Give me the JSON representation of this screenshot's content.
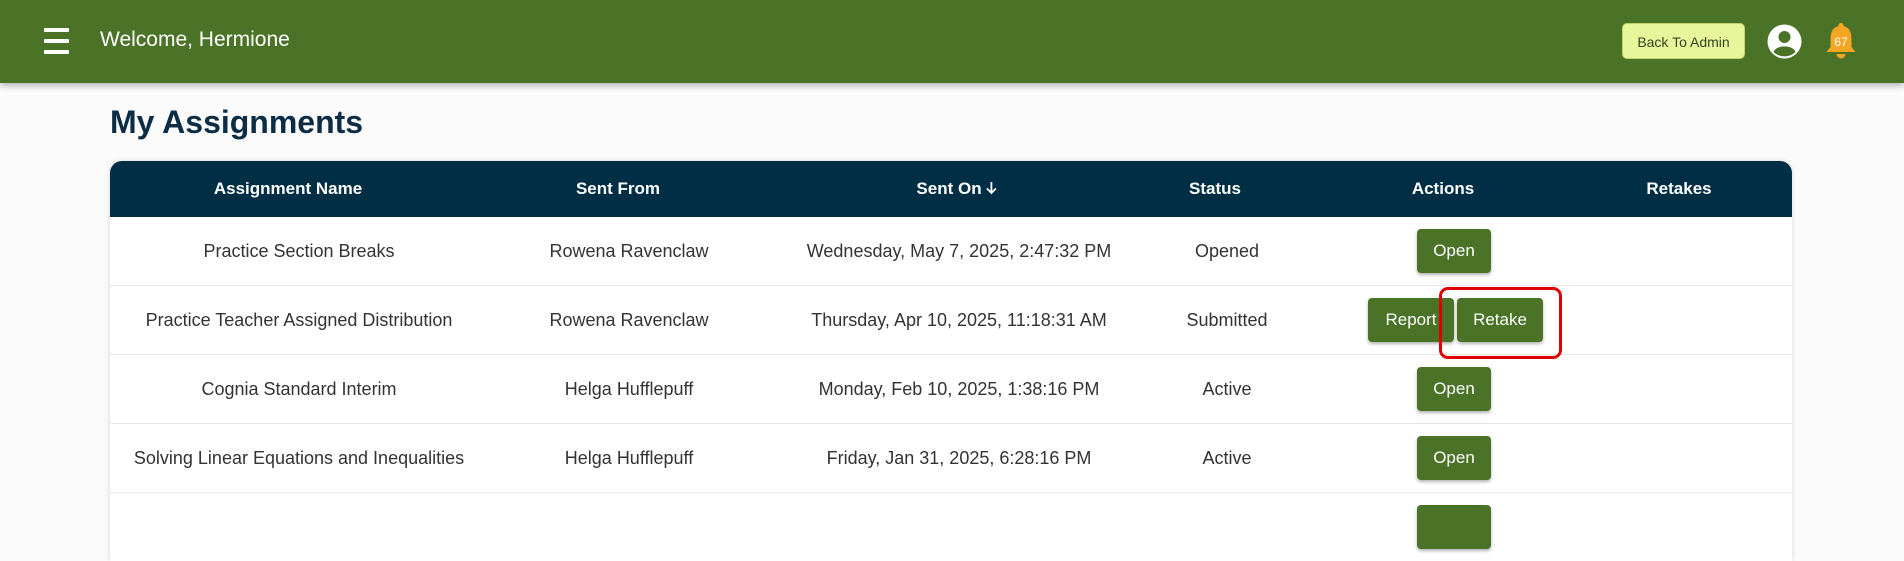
{
  "header": {
    "welcome": "Welcome, Hermione",
    "back_to_admin": "Back To Admin",
    "notification_count": "67",
    "colors": {
      "bar": "#4a7327",
      "admin_button": "#e7f59b",
      "bell": "#f5a623"
    }
  },
  "page": {
    "title": "My Assignments"
  },
  "table": {
    "columns": [
      "Assignment Name",
      "Sent From",
      "Sent On",
      "Status",
      "Actions",
      "Retakes"
    ],
    "sorted_column": "Sent On",
    "rows": [
      {
        "name": "Practice Section Breaks",
        "from": "Rowena Ravenclaw",
        "sent_on": "Wednesday, May 7, 2025, 2:47:32 PM",
        "status": "Opened",
        "actions": [
          "Open"
        ]
      },
      {
        "name": "Practice Teacher Assigned Distribution",
        "from": "Rowena Ravenclaw",
        "sent_on": "Thursday, Apr 10, 2025, 11:18:31 AM",
        "status": "Submitted",
        "actions": [
          "Report",
          "Retake"
        ]
      },
      {
        "name": "Cognia Standard Interim",
        "from": "Helga Hufflepuff",
        "sent_on": "Monday, Feb 10, 2025, 1:38:16 PM",
        "status": "Active",
        "actions": [
          "Open"
        ]
      },
      {
        "name": "Solving Linear Equations and Inequalities",
        "from": "Helga Hufflepuff",
        "sent_on": "Friday, Jan 31, 2025, 6:28:16 PM",
        "status": "Active",
        "actions": [
          "Open"
        ]
      }
    ],
    "colors": {
      "header": "#002e44",
      "button": "#4a7327",
      "highlight": "#e00000"
    }
  }
}
